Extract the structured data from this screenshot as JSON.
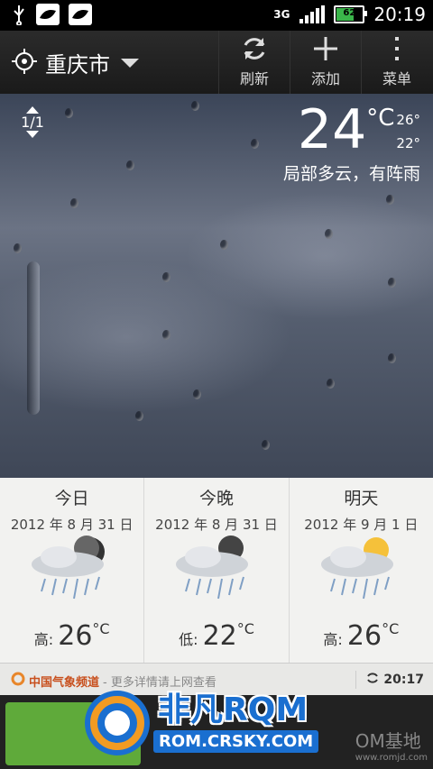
{
  "status_bar": {
    "network": "3G",
    "battery": "62",
    "time": "20:19"
  },
  "action_bar": {
    "city": "重庆市",
    "refresh_label": "刷新",
    "add_label": "添加",
    "menu_label": "菜单"
  },
  "current": {
    "pager": "1/1",
    "temp": "24",
    "unit": "°C",
    "high": "26°",
    "low": "22°",
    "condition": "局部多云，有阵雨"
  },
  "forecast": [
    {
      "day": "今日",
      "date": "2012 年 8 月 31 日",
      "temp_label": "高:",
      "temp": "26",
      "unit": "°C"
    },
    {
      "day": "今晚",
      "date": "2012 年 8 月 31 日",
      "temp_label": "低:",
      "temp": "22",
      "unit": "°C"
    },
    {
      "day": "明天",
      "date": "2012 年 9 月 1 日",
      "temp_label": "高:",
      "temp": "26",
      "unit": "°C"
    }
  ],
  "footer": {
    "source": "中国气象频道",
    "source_more": "- 更多详情请上网查看",
    "updated": "20:17"
  },
  "watermark": {
    "brand": "非凡RQM",
    "url": "ROM.CRSKY.COM",
    "site": "OM基地",
    "site_url": "www.romjd.com"
  }
}
